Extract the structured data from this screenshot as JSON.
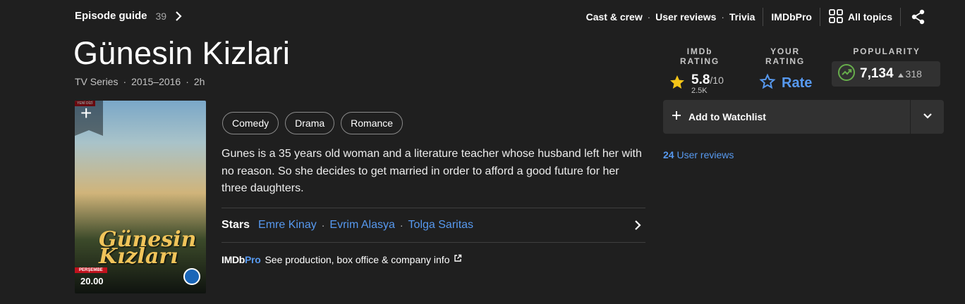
{
  "episode_guide": {
    "label": "Episode guide",
    "count": "39"
  },
  "top_nav": {
    "cast_crew": "Cast & crew",
    "user_reviews": "User reviews",
    "trivia": "Trivia",
    "imdbpro": "IMDbPro",
    "all_topics": "All topics",
    "separator": "·"
  },
  "title": "Günesin Kizlari",
  "meta": {
    "type": "TV Series",
    "years": "2015–2016",
    "runtime": "2h",
    "separator": "·"
  },
  "ratings": {
    "imdb_heading": "IMDb RATING",
    "imdb_score": "5.8",
    "imdb_out_of": "/10",
    "imdb_votes": "2.5K",
    "your_heading": "YOUR RATING",
    "rate_label": "Rate",
    "popularity_heading": "POPULARITY",
    "popularity_value": "7,134",
    "popularity_delta": "318"
  },
  "poster": {
    "logo_text": "Günesin Kızları",
    "day_badge": "PERŞEMBE",
    "air_time": "20.00",
    "ribbon": "YENİ DİZİ"
  },
  "genres": [
    "Comedy",
    "Drama",
    "Romance"
  ],
  "plot": "Gunes is a 35 years old woman and a literature teacher whose husband left her with no reason. So she decides to get married in order to afford a good future for her three daughters.",
  "stars": {
    "label": "Stars",
    "names": [
      "Emre Kinay",
      "Evrim Alasya",
      "Tolga Saritas"
    ],
    "separator": "·"
  },
  "imdbpro_row": {
    "logo_a": "IMDb",
    "logo_b": "Pro",
    "text": "See production, box office & company info"
  },
  "watchlist": {
    "label": "Add to Watchlist"
  },
  "user_reviews": {
    "count": "24",
    "label": "User reviews"
  },
  "colors": {
    "background": "#1f1f1f",
    "accent_blue": "#5799ef",
    "star_yellow": "#f5c518",
    "trend_green": "#67ad4b",
    "panel": "#313131"
  }
}
